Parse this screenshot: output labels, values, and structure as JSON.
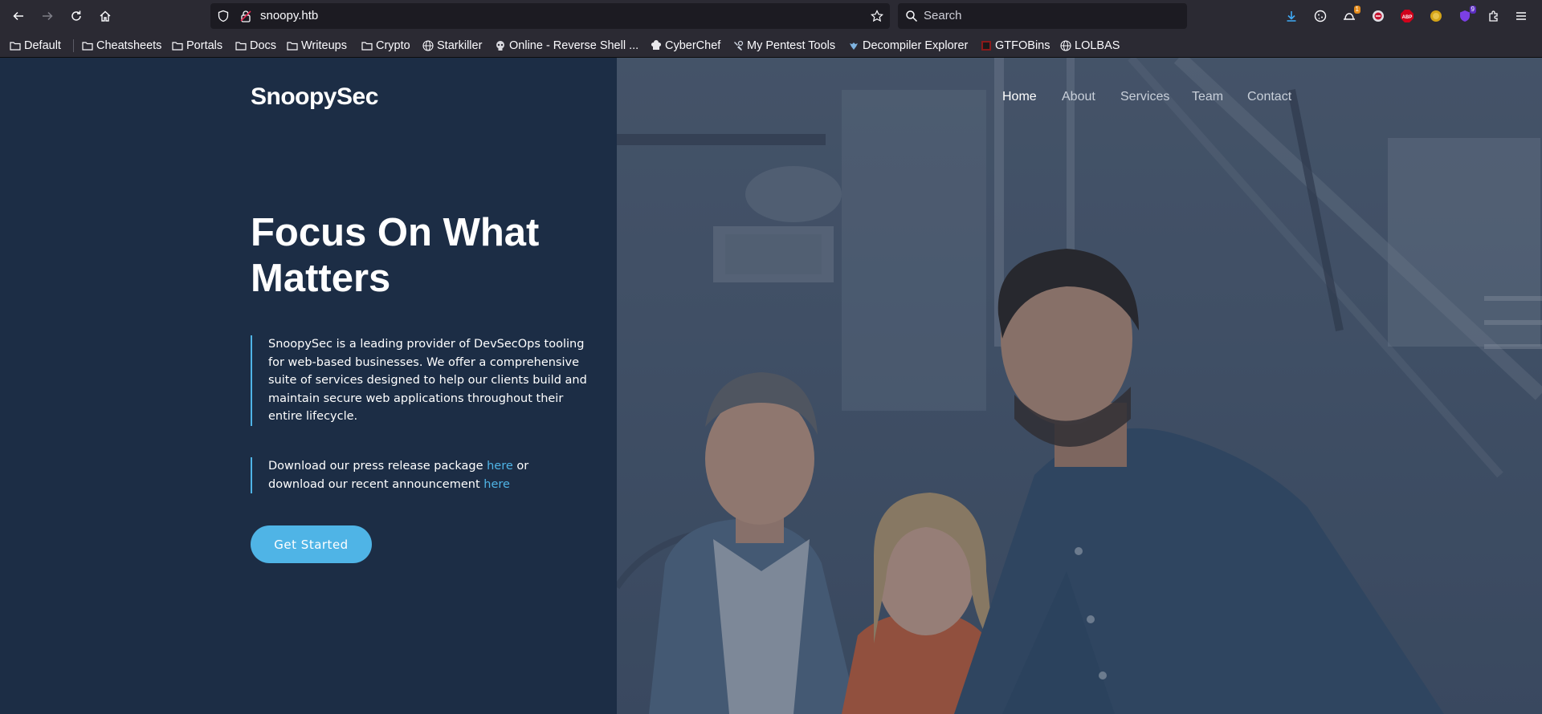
{
  "browser": {
    "url": "snoopy.htb",
    "search_placeholder": "Search",
    "extension_badges": {
      "ext2": "1",
      "ext7": "9"
    },
    "bookmarks": [
      {
        "label": "Default",
        "icon": "folder-icon"
      },
      {
        "label": "Cheatsheets",
        "icon": "folder-icon"
      },
      {
        "label": "Portals",
        "icon": "folder-icon"
      },
      {
        "label": "Docs",
        "icon": "folder-icon"
      },
      {
        "label": "Writeups",
        "icon": "folder-icon"
      },
      {
        "label": "Crypto",
        "icon": "folder-icon"
      },
      {
        "label": "Starkiller",
        "icon": "globe-icon"
      },
      {
        "label": "Online - Reverse Shell ...",
        "icon": "skull-icon"
      },
      {
        "label": "CyberChef",
        "icon": "chef-icon"
      },
      {
        "label": "My Pentest Tools",
        "icon": "tools-icon"
      },
      {
        "label": "Decompiler Explorer",
        "icon": "dogbolt-icon"
      },
      {
        "label": "GTFOBins",
        "icon": "gtfobins-icon"
      },
      {
        "label": "LOLBAS",
        "icon": "globe-icon"
      }
    ]
  },
  "site": {
    "brand": "SnoopySec",
    "nav": [
      "Home",
      "About",
      "Services",
      "Team",
      "Contact"
    ],
    "headline": "Focus On What Matters",
    "intro": "SnoopySec is a leading provider of DevSecOps tooling for web-based businesses. We offer a comprehensive suite of services designed to help our clients build and maintain secure web applications throughout their entire lifecycle.",
    "download": {
      "text1": "Download our press release package ",
      "link1": "here",
      "text2": " or download our recent announcement ",
      "link2": "here"
    },
    "cta": "Get Started"
  },
  "colors": {
    "accent": "#4fb4e6",
    "left_panel": "#1c2d45",
    "chrome": "#2b2a33"
  }
}
